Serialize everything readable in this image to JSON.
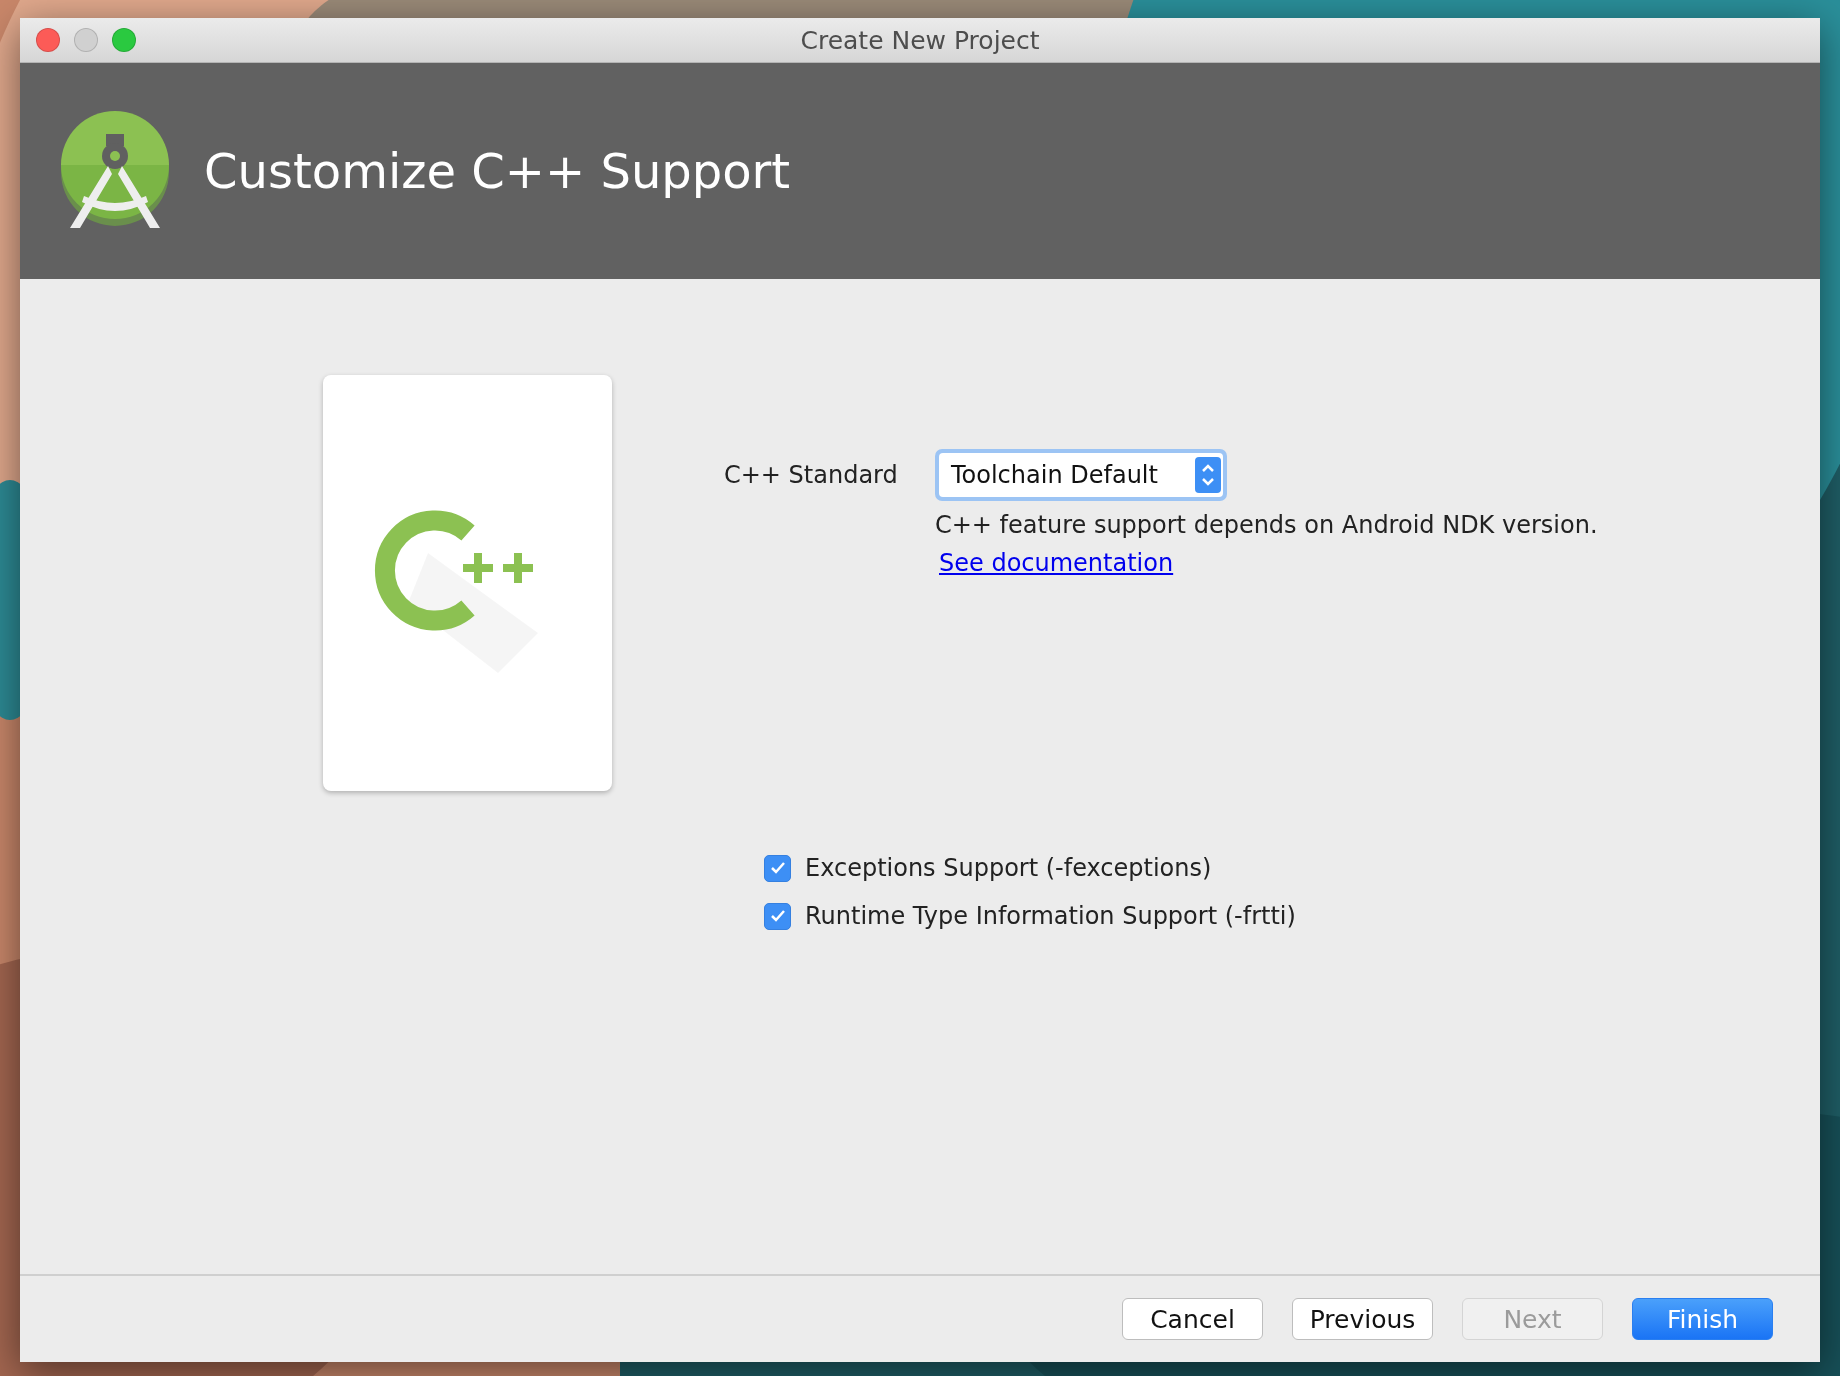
{
  "window": {
    "title": "Create New Project"
  },
  "header": {
    "title": "Customize C++ Support"
  },
  "cpp_standard": {
    "label": "C++ Standard",
    "value": "Toolchain Default"
  },
  "note": "C++ feature support depends on Android NDK version.",
  "link": "See documentation",
  "checkboxes": [
    {
      "label": "Exceptions Support (-fexceptions)",
      "checked": true
    },
    {
      "label": "Runtime Type Information Support (-frtti)",
      "checked": true
    }
  ],
  "buttons": [
    {
      "label": "Cancel",
      "kind": "default"
    },
    {
      "label": "Previous",
      "kind": "default"
    },
    {
      "label": "Next",
      "kind": "disabled"
    },
    {
      "label": "Finish",
      "kind": "primary"
    }
  ]
}
